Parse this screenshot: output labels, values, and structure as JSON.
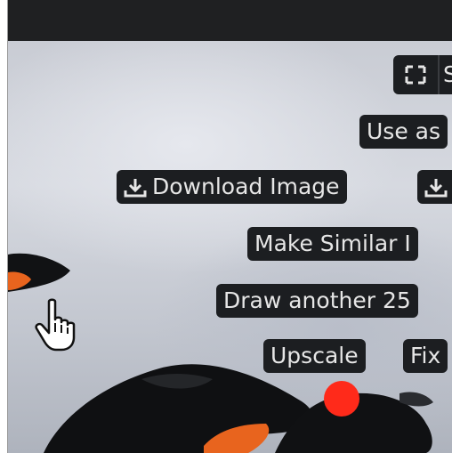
{
  "toolbar": {
    "fullscreen_icon": "fullscreen-icon",
    "split_button_text": "S"
  },
  "actions": {
    "use_as": "Use as",
    "download_image": "Download Image",
    "download_icon": "download-icon",
    "make_similar": "Make Similar I",
    "draw_another": "Draw another 25",
    "upscale": "Upscale",
    "fix": "Fix"
  },
  "colors": {
    "topbar": "#1f2022",
    "pill_bg": "#1c1e21",
    "pill_text": "#e6e6e6",
    "penguin_beak_orange": "#e8641e",
    "red_marker": "#ff2a1a"
  }
}
